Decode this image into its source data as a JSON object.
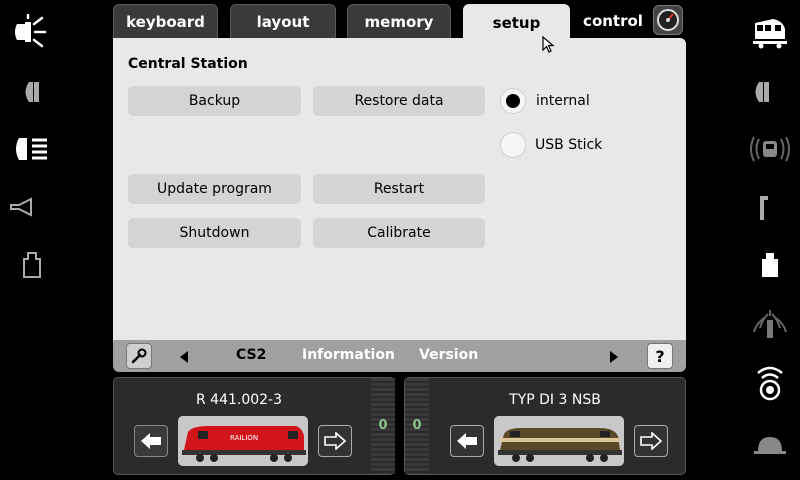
{
  "tabs": [
    {
      "label": "keyboard"
    },
    {
      "label": "layout"
    },
    {
      "label": "memory"
    },
    {
      "label": "setup"
    },
    {
      "label": "control"
    }
  ],
  "panel": {
    "title": "Central Station",
    "buttons": {
      "backup": "Backup",
      "restore": "Restore data",
      "update": "Update program",
      "restart": "Restart",
      "shutdown": "Shutdown",
      "calibrate": "Calibrate"
    },
    "radios": {
      "internal": "internal",
      "usb": "USB Stick",
      "selected": "internal"
    }
  },
  "bar": {
    "items": [
      "CS2",
      "Information",
      "Version"
    ],
    "help": "?"
  },
  "locos": [
    {
      "name": "R 441.002-3",
      "speed": "0"
    },
    {
      "name": "TYP DI 3 NSB",
      "speed": "0"
    }
  ],
  "left_icons": [
    "light-icon",
    "headlight-icon",
    "high-beam-icon",
    "horn-icon",
    "coupler-icon"
  ],
  "right_icons": [
    "train-icon",
    "headlight-icon",
    "cab-light-icon",
    "pantograph-icon",
    "coupler-icon",
    "smoke-icon",
    "radio-sound-icon",
    "dome-icon"
  ],
  "colors": {
    "active_tab": "#e8e8e8",
    "panel": "#e8e8e8",
    "bar": "#a0a0a0",
    "speed_text": "#8ec08e"
  }
}
